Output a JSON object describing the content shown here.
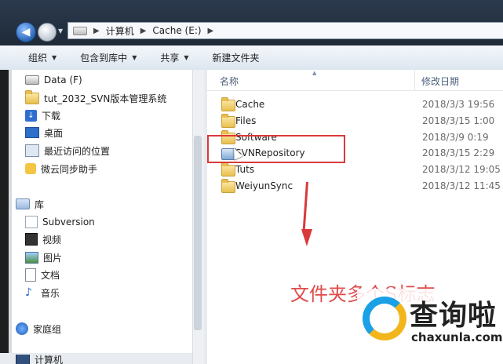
{
  "breadcrumb": {
    "items": [
      "计算机",
      "Cache (E:)"
    ]
  },
  "toolbar": {
    "organize": "组织",
    "include_in_library": "包含到库中",
    "share": "共享",
    "new_folder": "新建文件夹"
  },
  "nav": {
    "favorites": [
      {
        "label": "Data (F)",
        "icon": "drive-icon"
      },
      {
        "label": "tut_2032_SVN版本管理系统",
        "icon": "folder-icon"
      },
      {
        "label": "下载",
        "icon": "download-icon"
      },
      {
        "label": "桌面",
        "icon": "desktop-icon"
      },
      {
        "label": "最近访问的位置",
        "icon": "recent-icon"
      },
      {
        "label": "微云同步助手",
        "icon": "cloud-icon"
      }
    ],
    "libraries": {
      "label": "库",
      "items": [
        {
          "label": "Subversion",
          "icon": "svn-library-icon"
        },
        {
          "label": "视频",
          "icon": "video-icon"
        },
        {
          "label": "图片",
          "icon": "picture-icon"
        },
        {
          "label": "文档",
          "icon": "document-icon"
        },
        {
          "label": "音乐",
          "icon": "music-icon"
        }
      ]
    },
    "homegroup": "家庭组",
    "computer": "计算机"
  },
  "columns": {
    "name": "名称",
    "date_modified": "修改日期"
  },
  "files": [
    {
      "name": "Cache",
      "date": "2018/3/3 19:56"
    },
    {
      "name": "Files",
      "date": "2018/3/15 1:00"
    },
    {
      "name": "Software",
      "date": "2018/3/9 0:19"
    },
    {
      "name": "SVNRepository",
      "date": "2018/3/15 2:29"
    },
    {
      "name": "Tuts",
      "date": "2018/3/12 19:05"
    },
    {
      "name": "WeiyunSync",
      "date": "2018/3/12 11:45"
    }
  ],
  "annotation": {
    "text": "文件夹多个S标志",
    "color": "#e04a4a"
  },
  "watermark": {
    "cn": "查询啦",
    "en": "chaxunla.com"
  }
}
